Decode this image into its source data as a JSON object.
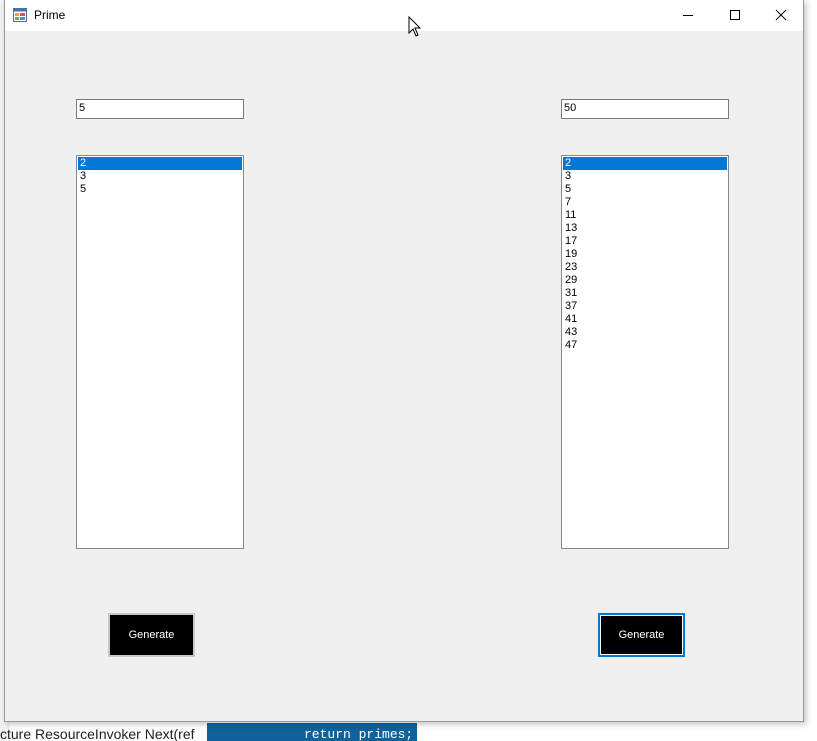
{
  "window": {
    "title": "Prime",
    "controls": [
      "minimize-icon",
      "maximize-icon",
      "close-icon"
    ]
  },
  "left_panel": {
    "input_value": "5",
    "list_items": [
      "2",
      "3",
      "5"
    ],
    "selected_index": 0,
    "button_label": "Generate"
  },
  "right_panel": {
    "input_value": "50",
    "list_items": [
      "2",
      "3",
      "5",
      "7",
      "11",
      "13",
      "17",
      "19",
      "23",
      "29",
      "31",
      "37",
      "41",
      "43",
      "47"
    ],
    "selected_index": 0,
    "button_label": "Generate"
  },
  "background": {
    "bottom_text": "cture ResourceInvoker Next(ref",
    "code_text": "return primes;",
    "accent": "#0078d7"
  }
}
